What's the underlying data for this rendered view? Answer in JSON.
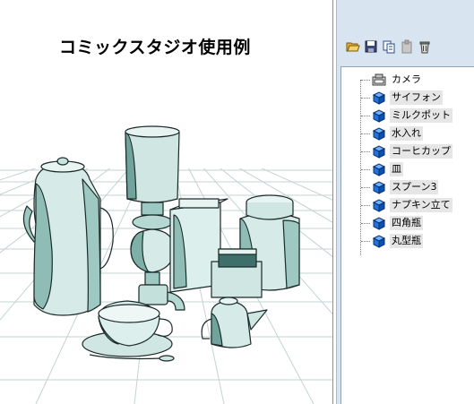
{
  "viewport": {
    "title": "コミックスタジオ使用例"
  },
  "toolbar": {
    "icons": [
      "open-folder-icon",
      "save-icon",
      "copy-icon",
      "paste-icon",
      "delete-icon"
    ]
  },
  "tree": {
    "items": [
      {
        "label": "カメラ",
        "icon": "camera-icon"
      },
      {
        "label": "サイフォン",
        "icon": "cube-icon"
      },
      {
        "label": "ミルクポット",
        "icon": "cube-icon"
      },
      {
        "label": "水入れ",
        "icon": "cube-icon"
      },
      {
        "label": "コーヒカップ",
        "icon": "cube-icon"
      },
      {
        "label": "皿",
        "icon": "cube-icon"
      },
      {
        "label": "スプーン3",
        "icon": "cube-icon"
      },
      {
        "label": "ナプキン立て",
        "icon": "cube-icon"
      },
      {
        "label": "四角瓶",
        "icon": "cube-icon"
      },
      {
        "label": "丸型瓶",
        "icon": "cube-icon"
      }
    ]
  },
  "colors": {
    "panel_bg": "#d9e4f1",
    "cube_blue": "#1e74e0",
    "tone": "#b8d8d2",
    "shade": "#5f9a92"
  }
}
